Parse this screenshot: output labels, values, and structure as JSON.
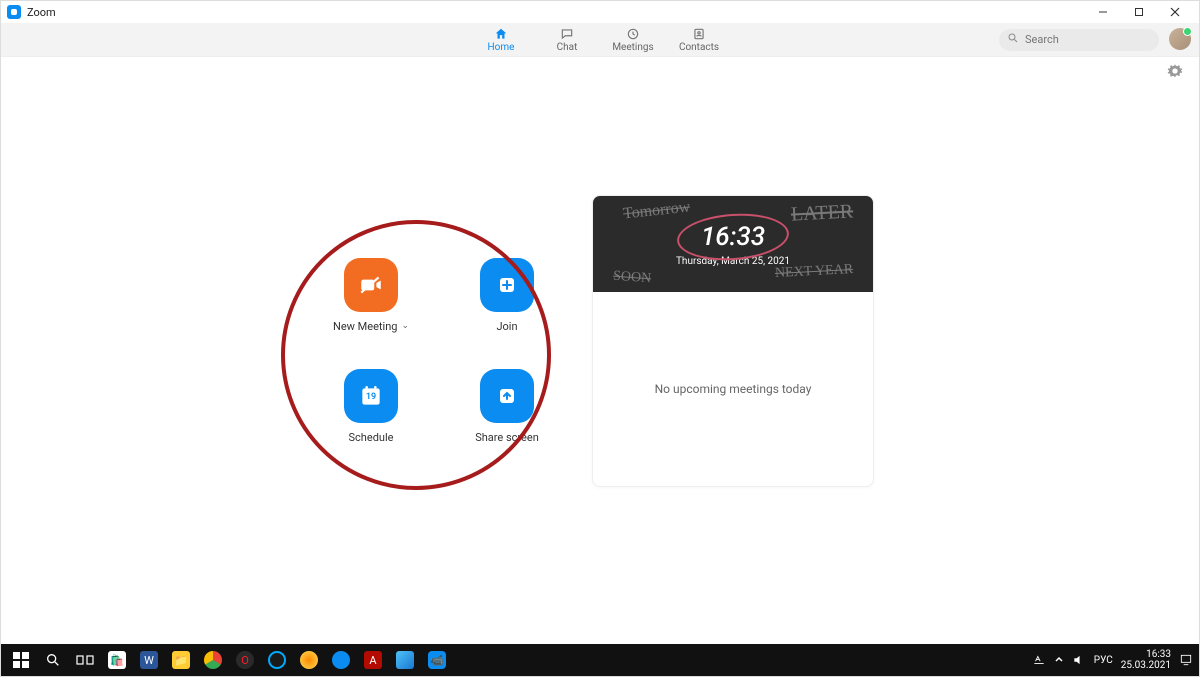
{
  "app": {
    "title": "Zoom"
  },
  "nav": {
    "tabs": [
      {
        "label": "Home",
        "active": true
      },
      {
        "label": "Chat",
        "active": false
      },
      {
        "label": "Meetings",
        "active": false
      },
      {
        "label": "Contacts",
        "active": false
      }
    ]
  },
  "search": {
    "placeholder": "Search"
  },
  "actions": {
    "newMeeting": {
      "label": "New Meeting"
    },
    "join": {
      "label": "Join"
    },
    "schedule": {
      "label": "Schedule",
      "day": "19"
    },
    "share": {
      "label": "Share screen"
    }
  },
  "banner": {
    "time": "16:33",
    "date": "Thursday, March 25, 2021",
    "scrawls": [
      "Tomorrow",
      "LATER",
      "SOON",
      "NEXT YEAR"
    ]
  },
  "upcoming": {
    "empty_text": "No upcoming meetings today"
  },
  "systray": {
    "lang": "РУС",
    "time": "16:33",
    "date": "25.03.2021"
  }
}
